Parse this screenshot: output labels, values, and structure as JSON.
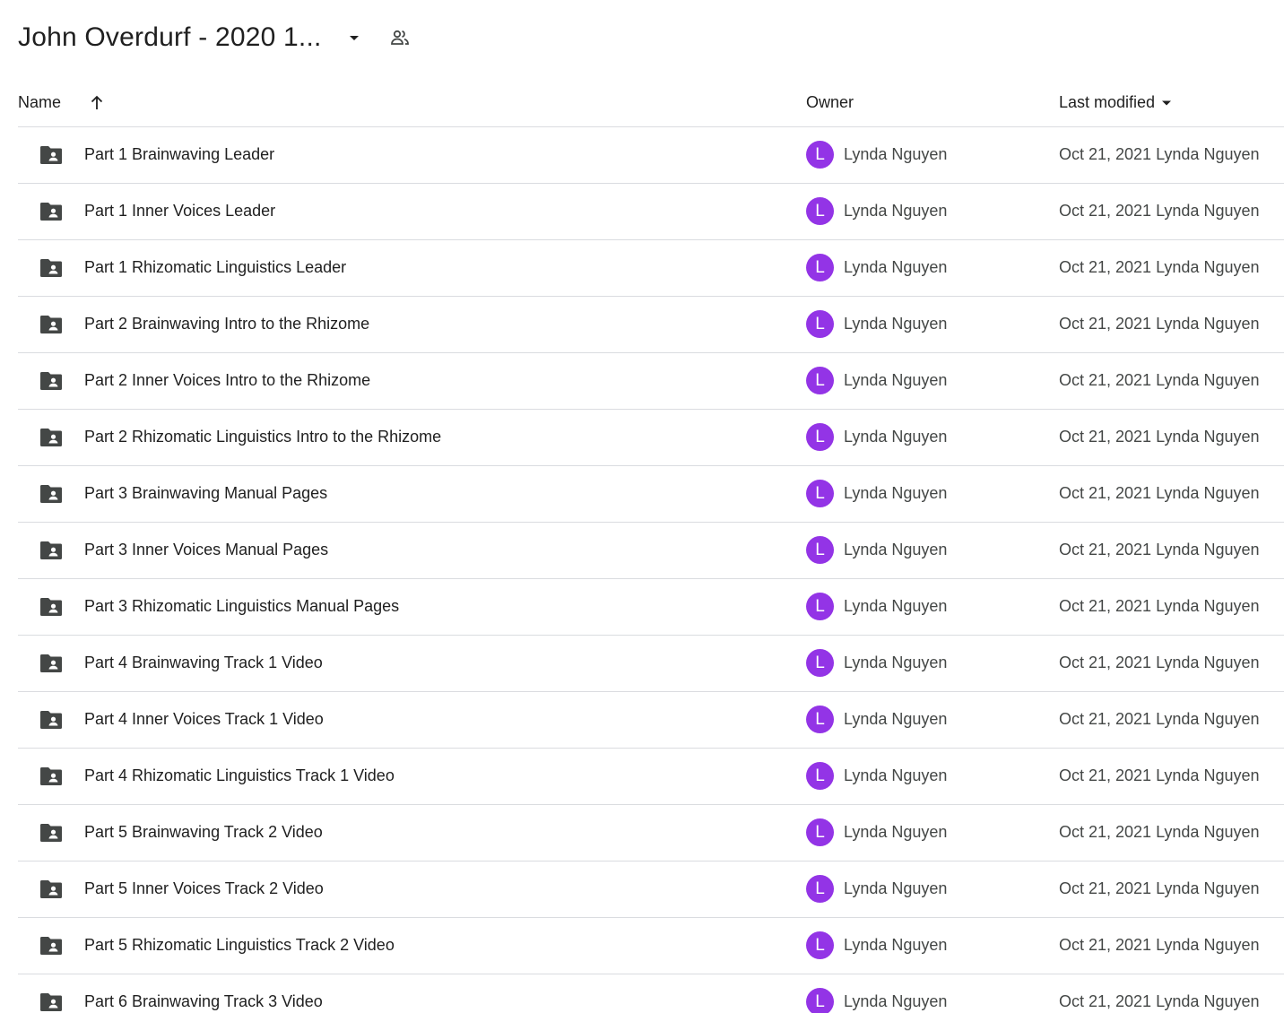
{
  "header": {
    "title": "John Overdurf - 2020 1...",
    "dropdown_icon": "arrow-drop-down-icon",
    "shared_icon": "people-icon"
  },
  "columns": {
    "name": "Name",
    "owner": "Owner",
    "last_modified": "Last modified",
    "sort_icon": "arrow-up-icon",
    "modified_sort_icon": "caret-down-icon"
  },
  "colors": {
    "avatar_bg": "#9334e6",
    "divider": "#dadce0",
    "folder_icon": "#444746"
  },
  "rows": [
    {
      "name": "Part 1 Brainwaving Leader",
      "owner_initial": "L",
      "owner": "Lynda Nguyen",
      "modified": "Oct 21, 2021 Lynda Nguyen"
    },
    {
      "name": "Part 1 Inner Voices Leader",
      "owner_initial": "L",
      "owner": "Lynda Nguyen",
      "modified": "Oct 21, 2021 Lynda Nguyen"
    },
    {
      "name": "Part 1 Rhizomatic Linguistics Leader",
      "owner_initial": "L",
      "owner": "Lynda Nguyen",
      "modified": "Oct 21, 2021 Lynda Nguyen"
    },
    {
      "name": "Part 2 Brainwaving Intro to the Rhizome",
      "owner_initial": "L",
      "owner": "Lynda Nguyen",
      "modified": "Oct 21, 2021 Lynda Nguyen"
    },
    {
      "name": "Part 2 Inner Voices Intro to the Rhizome",
      "owner_initial": "L",
      "owner": "Lynda Nguyen",
      "modified": "Oct 21, 2021 Lynda Nguyen"
    },
    {
      "name": "Part 2 Rhizomatic Linguistics Intro to the Rhizome",
      "owner_initial": "L",
      "owner": "Lynda Nguyen",
      "modified": "Oct 21, 2021 Lynda Nguyen"
    },
    {
      "name": "Part 3 Brainwaving Manual Pages",
      "owner_initial": "L",
      "owner": "Lynda Nguyen",
      "modified": "Oct 21, 2021 Lynda Nguyen"
    },
    {
      "name": "Part 3 Inner Voices Manual Pages",
      "owner_initial": "L",
      "owner": "Lynda Nguyen",
      "modified": "Oct 21, 2021 Lynda Nguyen"
    },
    {
      "name": "Part 3 Rhizomatic Linguistics Manual Pages",
      "owner_initial": "L",
      "owner": "Lynda Nguyen",
      "modified": "Oct 21, 2021 Lynda Nguyen"
    },
    {
      "name": "Part 4 Brainwaving Track 1 Video",
      "owner_initial": "L",
      "owner": "Lynda Nguyen",
      "modified": "Oct 21, 2021 Lynda Nguyen"
    },
    {
      "name": "Part 4 Inner Voices Track 1 Video",
      "owner_initial": "L",
      "owner": "Lynda Nguyen",
      "modified": "Oct 21, 2021 Lynda Nguyen"
    },
    {
      "name": "Part 4 Rhizomatic Linguistics Track 1 Video",
      "owner_initial": "L",
      "owner": "Lynda Nguyen",
      "modified": "Oct 21, 2021 Lynda Nguyen"
    },
    {
      "name": "Part 5 Brainwaving Track 2 Video",
      "owner_initial": "L",
      "owner": "Lynda Nguyen",
      "modified": "Oct 21, 2021 Lynda Nguyen"
    },
    {
      "name": "Part 5 Inner Voices Track 2 Video",
      "owner_initial": "L",
      "owner": "Lynda Nguyen",
      "modified": "Oct 21, 2021 Lynda Nguyen"
    },
    {
      "name": "Part 5 Rhizomatic Linguistics Track 2 Video",
      "owner_initial": "L",
      "owner": "Lynda Nguyen",
      "modified": "Oct 21, 2021 Lynda Nguyen"
    },
    {
      "name": "Part 6 Brainwaving Track 3 Video",
      "owner_initial": "L",
      "owner": "Lynda Nguyen",
      "modified": "Oct 21, 2021 Lynda Nguyen"
    }
  ]
}
